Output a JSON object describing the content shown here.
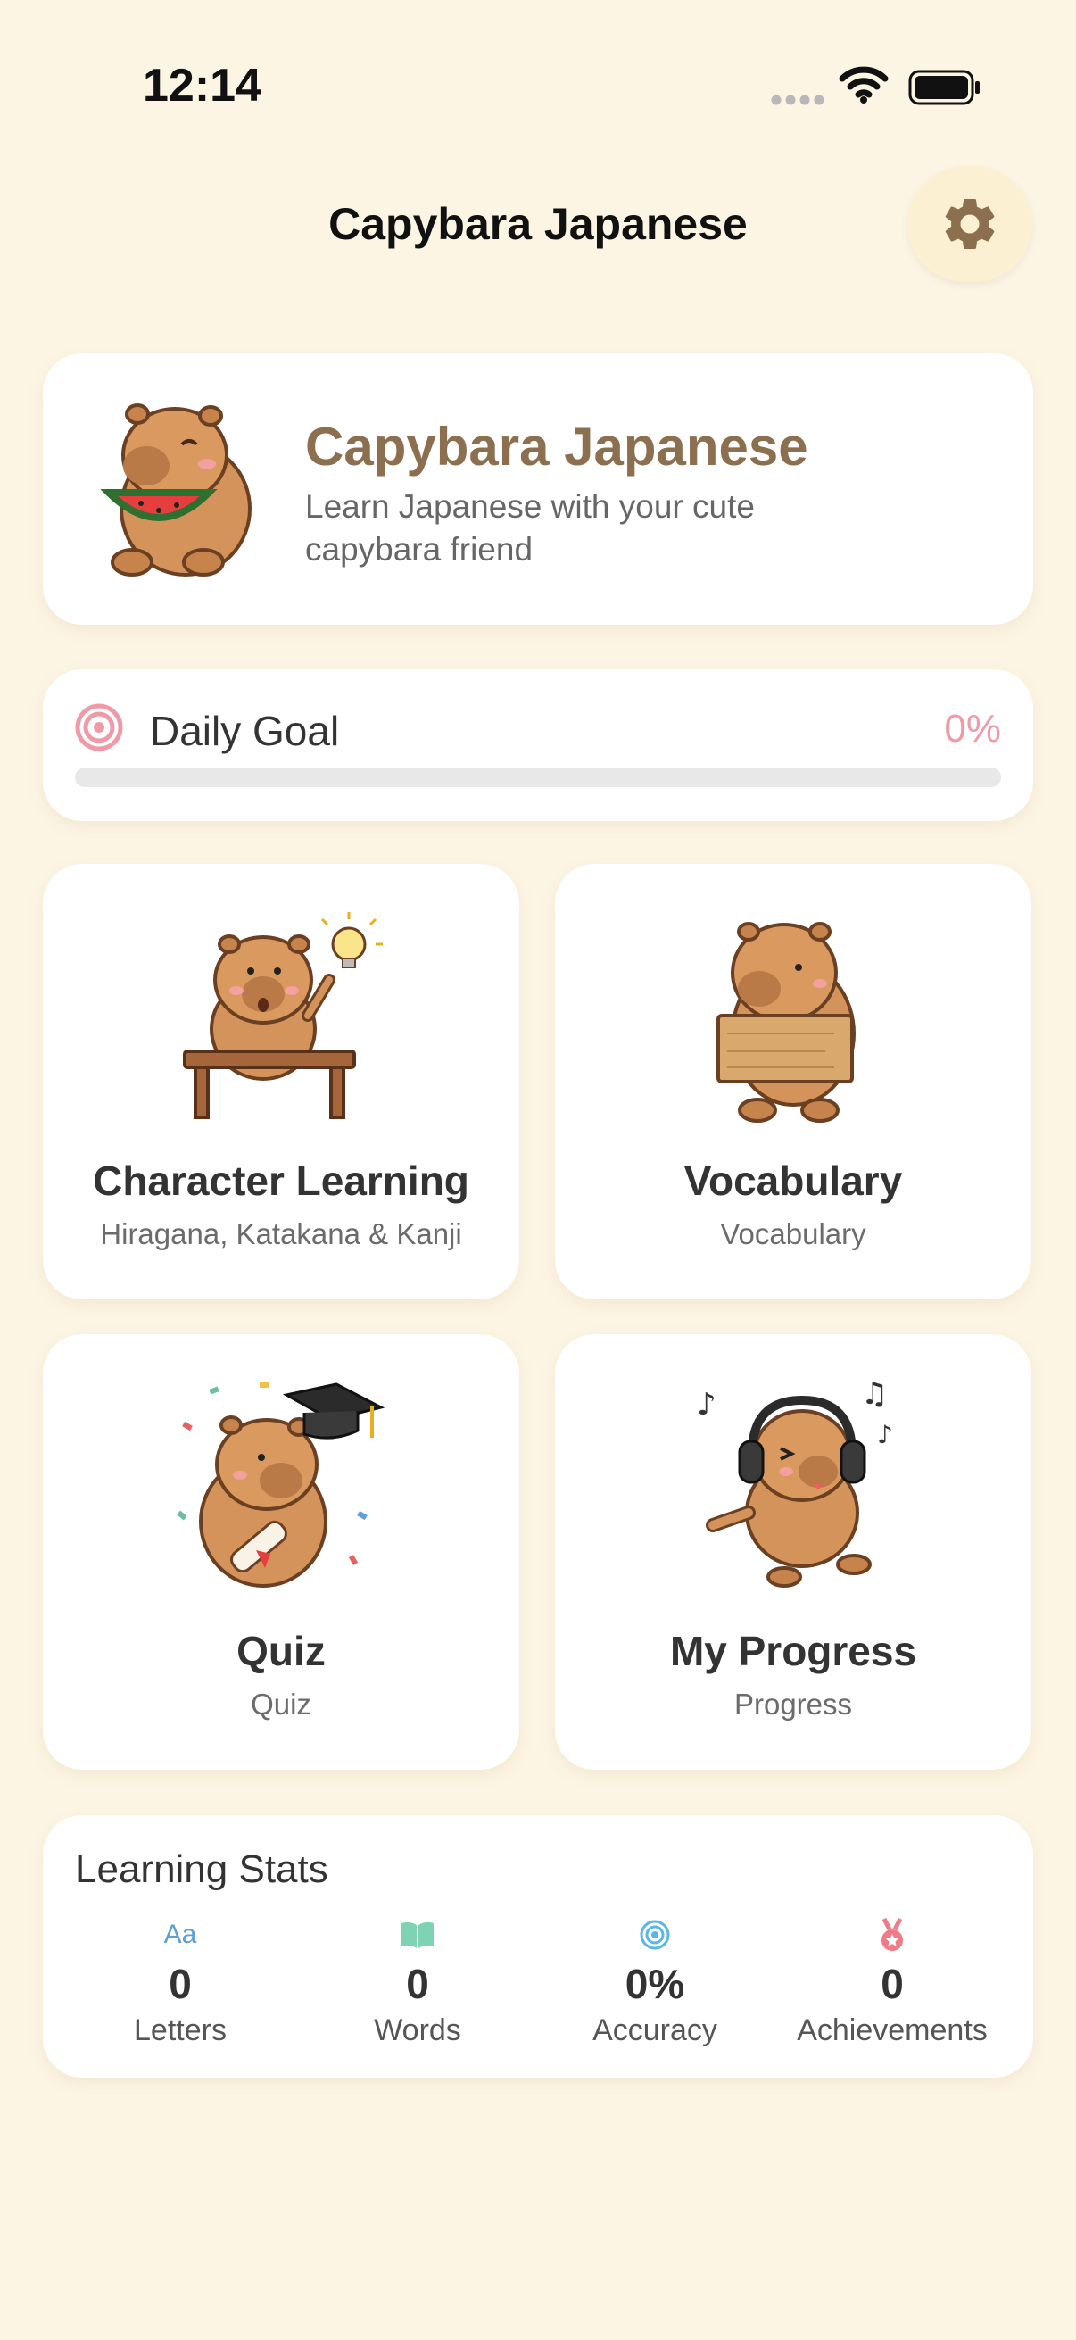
{
  "status_bar": {
    "time": "12:14"
  },
  "nav": {
    "title": "Capybara Japanese",
    "settings_icon": "gear-icon"
  },
  "hero": {
    "title": "Capybara Japanese",
    "subtitle": "Learn Japanese with your cute capybara friend"
  },
  "daily_goal": {
    "label": "Daily Goal",
    "percent_text": "0%",
    "progress": 0
  },
  "features": [
    {
      "title": "Character Learning",
      "subtitle": "Hiragana, Katakana & Kanji"
    },
    {
      "title": "Vocabulary",
      "subtitle": "Vocabulary"
    },
    {
      "title": "Quiz",
      "subtitle": "Quiz"
    },
    {
      "title": "My Progress",
      "subtitle": "Progress"
    }
  ],
  "stats": {
    "title": "Learning Stats",
    "items": [
      {
        "icon_text": "Aa",
        "icon": "letters-icon",
        "value": "0",
        "label": "Letters"
      },
      {
        "icon": "book-icon",
        "value": "0",
        "label": "Words"
      },
      {
        "icon": "target-icon",
        "value": "0%",
        "label": "Accuracy"
      },
      {
        "icon": "medal-icon",
        "value": "0",
        "label": "Achievements"
      }
    ]
  },
  "colors": {
    "background": "#fdf5e4",
    "brand_brown": "#8b6f4e",
    "goal_pink": "#f09aa8",
    "letters_blue": "#5aa0d8",
    "book_green": "#7fd3b5",
    "target_blue": "#5ab8e0",
    "medal_red": "#f07a86"
  }
}
